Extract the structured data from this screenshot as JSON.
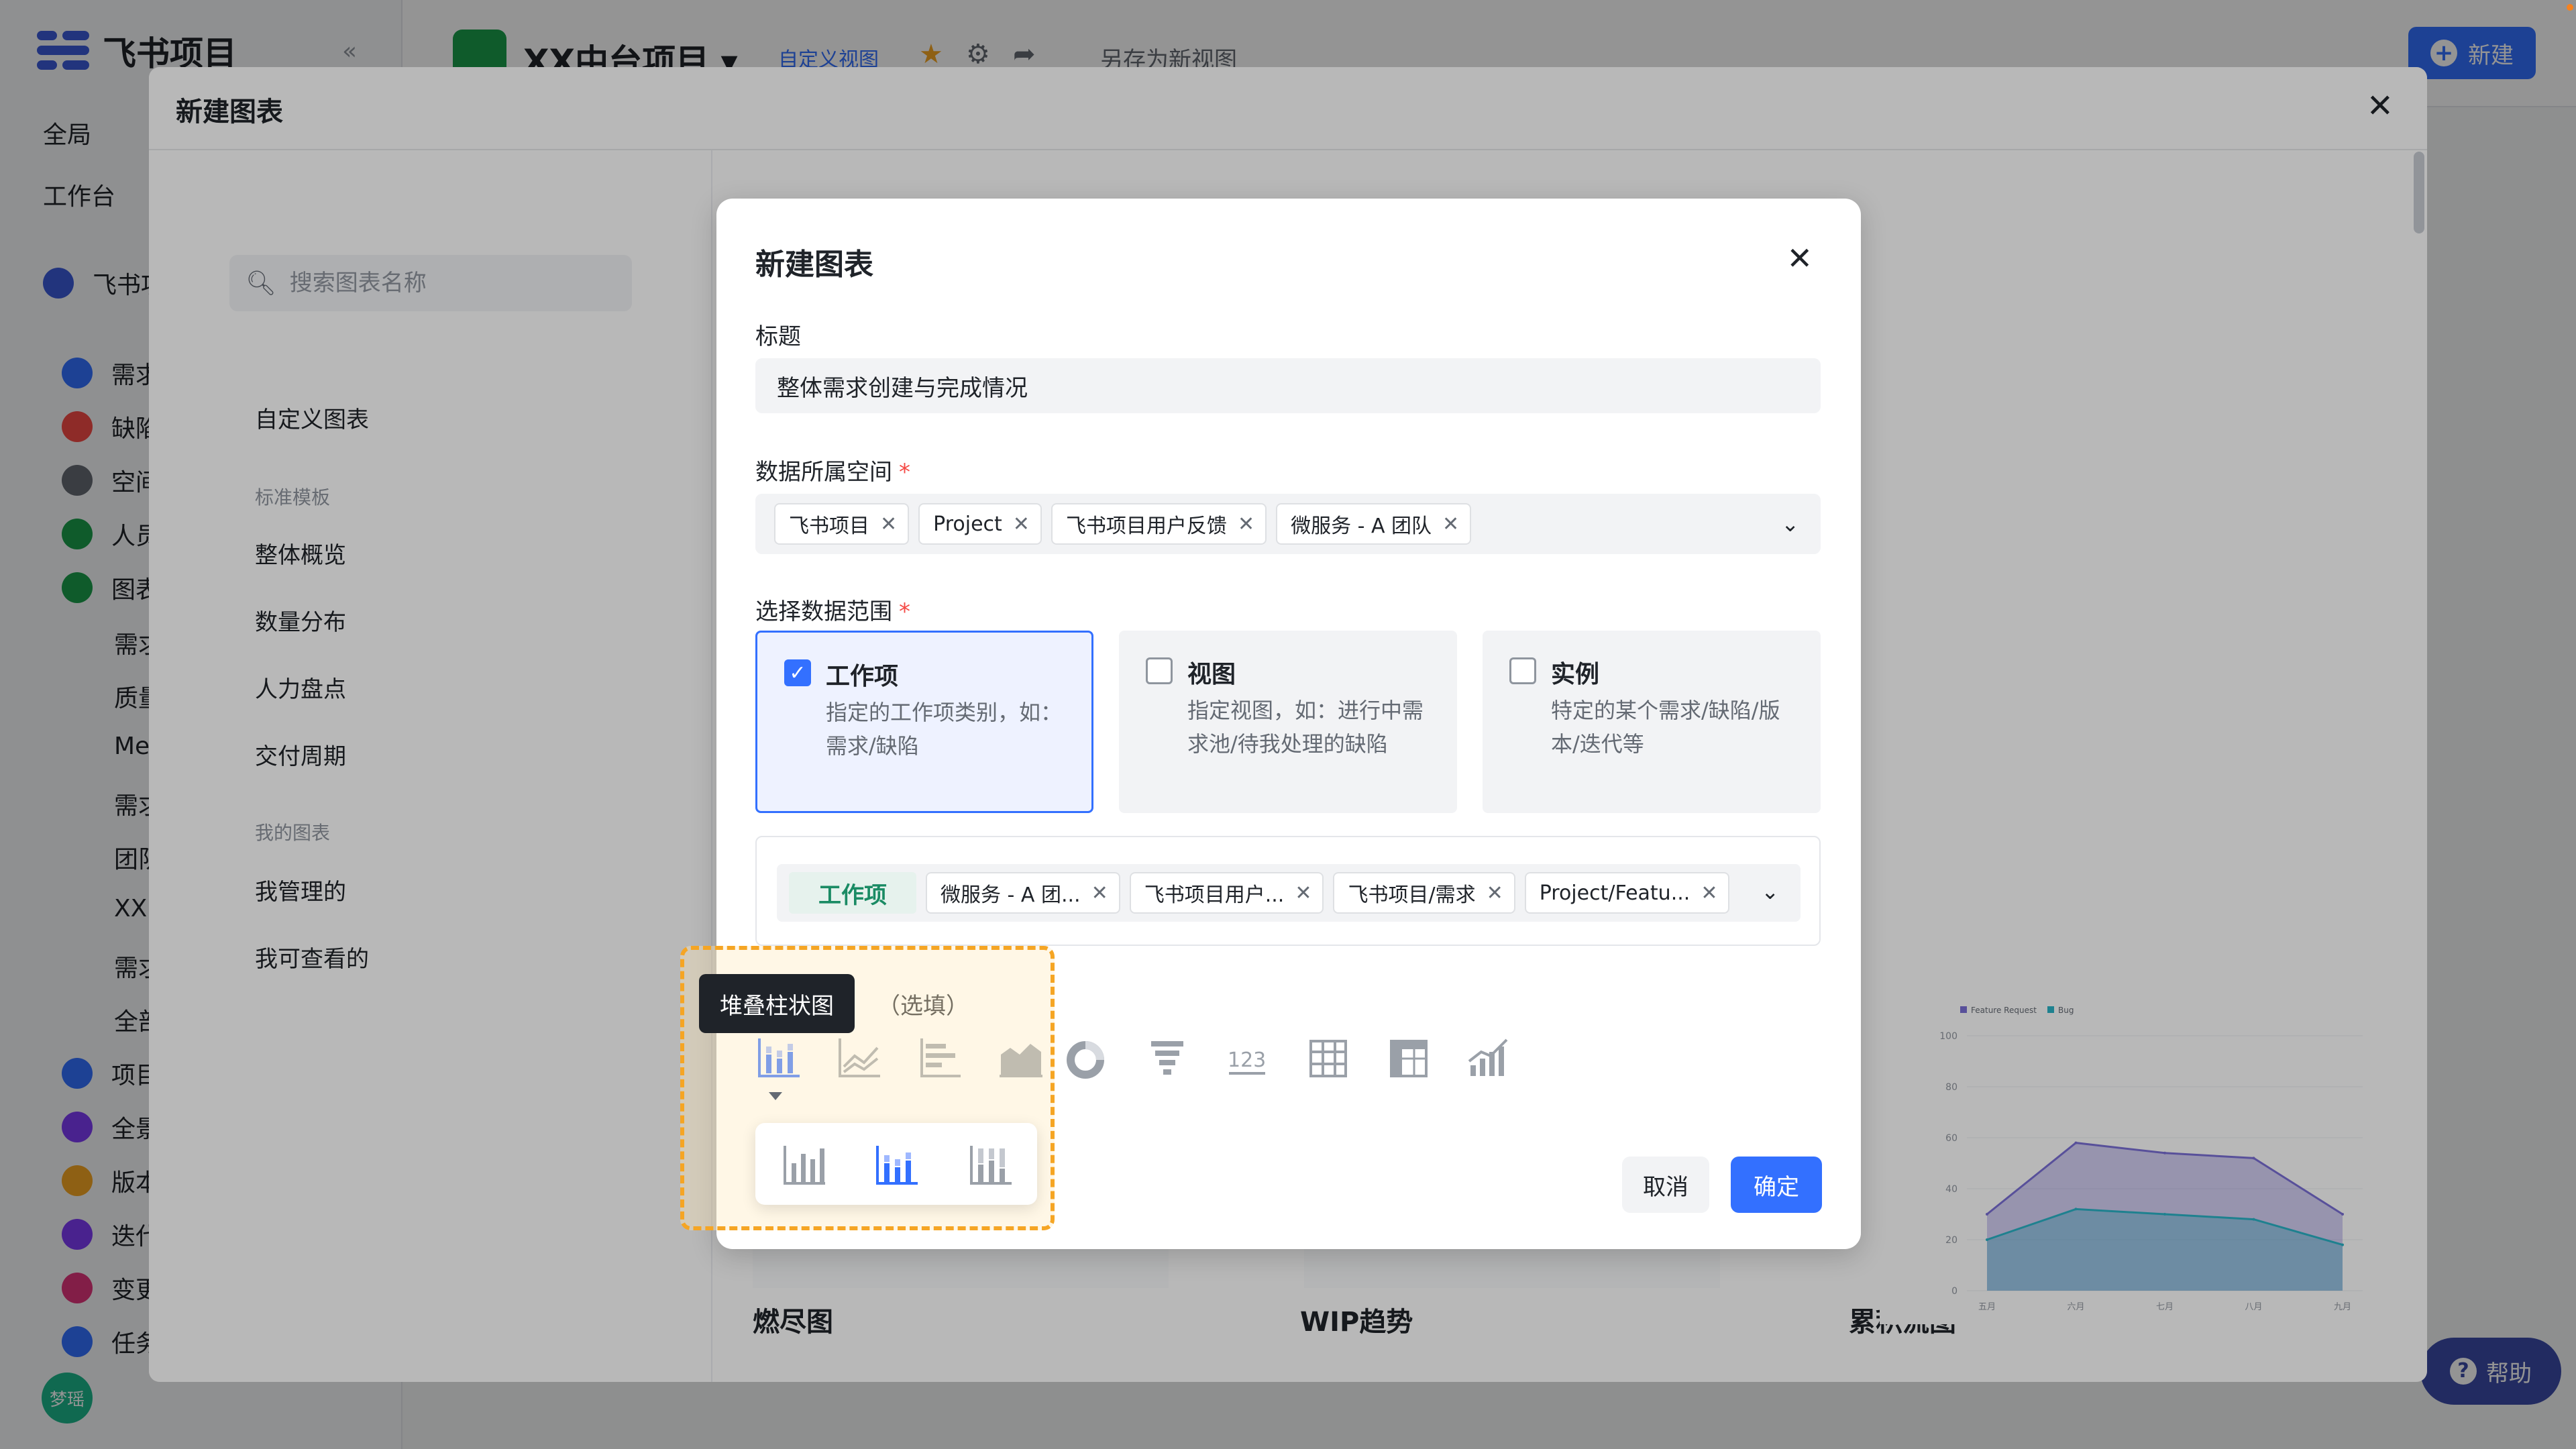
{
  "app": {
    "logo_text": "飞书项目",
    "project_title": "XX中台项目",
    "header_tab": "自定义视图",
    "header_link": "另存为新视图",
    "new_button": "新建",
    "help_button": "帮助",
    "avatar_text": "梦瑶",
    "sidebar_rows": [
      {
        "label": "全局",
        "color": ""
      },
      {
        "label": "工作台",
        "color": ""
      },
      {
        "label": "飞书项",
        "color": "#3c5bd8"
      },
      {
        "label": "需求",
        "color": "#3370ff"
      },
      {
        "label": "缺陷",
        "color": "#f54a45"
      },
      {
        "label": "空间",
        "color": "#646a73"
      },
      {
        "label": "人员",
        "color": "#1a9e4a"
      },
      {
        "label": "图表",
        "color": "#1a9e4a"
      },
      {
        "label": "需求",
        "color": ""
      },
      {
        "label": "质量",
        "color": ""
      },
      {
        "label": "Me",
        "color": ""
      },
      {
        "label": "需求",
        "color": ""
      },
      {
        "label": "团队",
        "color": ""
      },
      {
        "label": "XX",
        "color": ""
      },
      {
        "label": "需求",
        "color": ""
      },
      {
        "label": "全部",
        "color": ""
      },
      {
        "label": "项目",
        "color": "#3370ff"
      },
      {
        "label": "全景",
        "color": "#7f3bf5"
      },
      {
        "label": "版本",
        "color": "#f5a524"
      },
      {
        "label": "迭代",
        "color": "#7f3bf5"
      },
      {
        "label": "变更",
        "color": "#e0357a"
      },
      {
        "label": "任务",
        "color": "#3370ff"
      }
    ]
  },
  "big_dialog": {
    "title": "新建图表",
    "search_placeholder": "搜索图表名称",
    "menu": {
      "custom": "自定义图表",
      "group_standard": "标准模板",
      "overview": "整体概览",
      "distribution": "数量分布",
      "manpower": "人力盘点",
      "delivery": "交付周期",
      "group_mine": "我的图表",
      "managed": "我管理的",
      "viewable": "我可查看的"
    },
    "cards": [
      "燃尽图",
      "WIP趋势",
      "累积流图"
    ]
  },
  "mini_chart": {
    "legend": [
      "Feature Request",
      "Bug"
    ],
    "y_ticks": [
      "100",
      "80",
      "60",
      "40",
      "20",
      "0"
    ],
    "x_ticks": [
      "五月",
      "六月",
      "七月",
      "八月",
      "九月"
    ],
    "colors": {
      "feature": "#7b6fd6",
      "bug": "#2ab3c7"
    },
    "chart_data": {
      "type": "area",
      "categories": [
        "五月",
        "六月",
        "七月",
        "八月",
        "九月"
      ],
      "series": [
        {
          "name": "Feature Request",
          "values": [
            30,
            58,
            54,
            52,
            30
          ]
        },
        {
          "name": "Bug",
          "values": [
            20,
            32,
            30,
            28,
            18
          ]
        }
      ],
      "ylim": [
        0,
        100
      ]
    }
  },
  "new_chart": {
    "title": "新建图表",
    "title_label": "标题",
    "title_value": "整体需求创建与完成情况",
    "space_label": "数据所属空间",
    "required_mark": "*",
    "spaces": [
      "飞书项目",
      "Project",
      "飞书项目用户反馈",
      "微服务 - A 团队"
    ],
    "scope_label": "选择数据范围",
    "scopes": [
      {
        "name": "工作项",
        "desc": "指定的工作项类别，如：需求/缺陷",
        "checked": true
      },
      {
        "name": "视图",
        "desc": "指定视图，如：进行中需求池/待我处理的缺陷",
        "checked": false
      },
      {
        "name": "实例",
        "desc": "特定的某个需求/缺陷/版本/迭代等",
        "checked": false
      }
    ],
    "workitem_label": "工作项",
    "workitems": [
      "微服务 - A 团...",
      "飞书项目用户...",
      "飞书项目/需求",
      "Project/Featu..."
    ],
    "optional_label": "（选填）",
    "tooltip": "堆叠柱状图",
    "cancel": "取消",
    "confirm": "确定",
    "chart_type_icons": [
      "stacked-bar-icon",
      "line-chart-icon",
      "horizontal-bar-icon",
      "area-chart-icon",
      "donut-chart-icon",
      "funnel-chart-icon",
      "number-chart-icon",
      "table-icon",
      "pivot-table-icon",
      "combo-chart-icon"
    ],
    "sub_types": [
      "bar-chart-icon",
      "stacked-bar-icon",
      "percent-bar-icon"
    ],
    "accent": "#3370ff",
    "highlight": "#f5a524"
  }
}
